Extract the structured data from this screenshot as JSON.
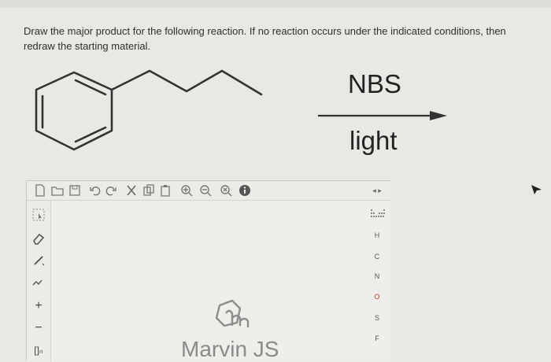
{
  "question": {
    "text": "Draw the major product for the following reaction. If no reaction occurs under the indicated conditions, then redraw the starting material."
  },
  "reaction": {
    "reagent_top": "NBS",
    "reagent_bottom": "light"
  },
  "editor": {
    "brand": "Marvin JS",
    "top_toolbar_icons": [
      "new-document-icon",
      "open-icon",
      "save-icon",
      "undo-icon",
      "redo-icon",
      "cut-icon",
      "copy-icon",
      "paste-icon",
      "zoom-in-icon",
      "zoom-out-icon",
      "zoom-reset-icon",
      "info-icon"
    ],
    "left_toolbar_icons": [
      "select-icon",
      "eraser-icon",
      "single-bond-icon",
      "chain-icon",
      "plus-charge-icon",
      "minus-charge-icon",
      "bracket-icon"
    ],
    "elements": [
      "H",
      "C",
      "N",
      "O",
      "S",
      "F"
    ],
    "bracket_label": "[]ₙ"
  }
}
